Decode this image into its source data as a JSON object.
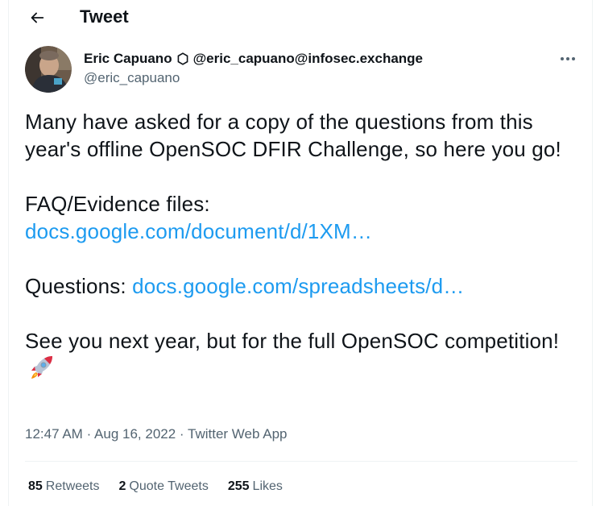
{
  "header": {
    "title": "Tweet",
    "back_icon": "arrow-left-icon"
  },
  "author": {
    "display_name": "Eric Capuano",
    "badge_icon": "hexagon-outline-icon",
    "mastodon_handle": "@eric_capuano@infosec.exchange",
    "handle": "@eric_capuano",
    "avatar": "profile-photo"
  },
  "more_icon": "more-horizontal-icon",
  "tweet": {
    "line1": "Many have asked for a copy of the questions from this year's offline OpenSOC DFIR Challenge, so here you go!",
    "faq_label": "FAQ/Evidence files:",
    "faq_link": "docs.google.com/document/d/1XM…",
    "questions_label": "Questions:",
    "questions_link": "docs.google.com/spreadsheets/d…",
    "closing": "See you next year, but for the full OpenSOC competition!",
    "emoji_icon": "rocket-emoji-icon"
  },
  "meta": {
    "time": "12:47 AM",
    "date": "Aug 16, 2022",
    "source": "Twitter Web App",
    "separator": "·"
  },
  "stats": {
    "retweets_count": "85",
    "retweets_label": "Retweets",
    "quotes_count": "2",
    "quotes_label": "Quote Tweets",
    "likes_count": "255",
    "likes_label": "Likes"
  },
  "colors": {
    "text": "#0f1419",
    "secondary": "#536471",
    "link": "#1d9bf0",
    "divider": "#eff3f4"
  }
}
